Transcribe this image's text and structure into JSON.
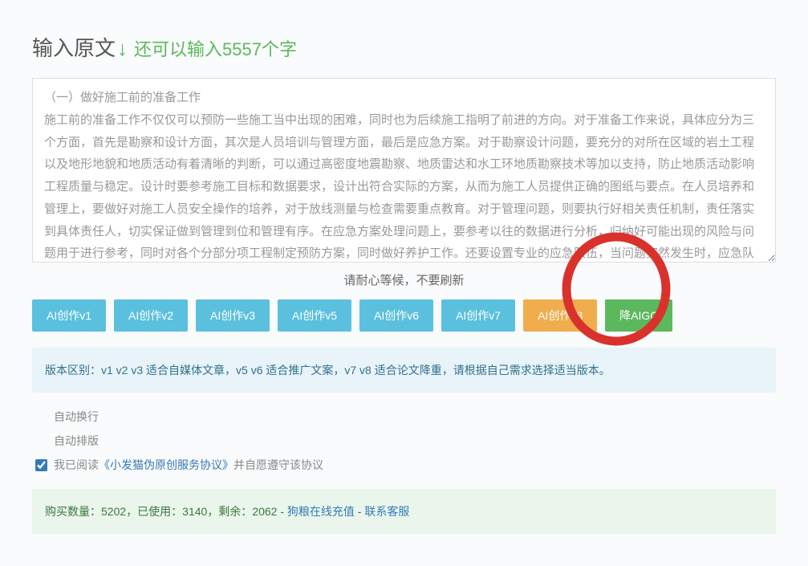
{
  "header": {
    "title": "输入原文",
    "arrow": "↓",
    "counter": "还可以输入5557个字"
  },
  "textarea": {
    "content": "（一）做好施工前的准备工作\n施工前的准备工作不仅仅可以预防一些施工当中出现的困难，同时也为后续施工指明了前进的方向。对于准备工作来说，具体应分为三个方面，首先是勘察和设计方面，其次是人员培训与管理方面，最后是应急方案。对于勘察设计问题，要充分的对所在区域的岩土工程以及地形地貌和地质活动有着清晰的判断，可以通过高密度地震勘察、地质雷达和水工环地质勘察技术等加以支持，防止地质活动影响工程质量与稳定。设计时要参考施工目标和数据要求，设计出符合实际的方案，从而为施工人员提供正确的图纸与要点。在人员培养和管理上，要做好对施工人员安全操作的培养，对于放线测量与检查需要重点教育。对于管理问题，则要执行好相关责任机制，责任落实到具体责任人，切实保证做到管理到位和管理有序。在应急方案处理问题上，要参考以往的数据进行分析，归纳好可能出现的风险与问题用于进行参考，同时对各个分部分项工程制定预防方案，同时做好养护工作。还要设置专业的应急队伍，当问题突然发生时，应急队伍要及时赶赴现场并做好问题的解决。"
  },
  "waiting_message": "请耐心等候，不要刷新",
  "buttons": {
    "v1": "AI创作v1",
    "v2": "AI创作v2",
    "v3": "AI创作v3",
    "v5": "AI创作v5",
    "v6": "AI创作v6",
    "v7": "AI创作v7",
    "v8": "AI创作v8",
    "aigc": "降AIGC"
  },
  "version_info": "版本区别：v1 v2 v3 适合自媒体文章，v5 v6 适合推广文案，v7 v8 适合论文降重，请根据自己需求选择适当版本。",
  "checkboxes": {
    "auto_wrap": "自动换行",
    "auto_format": "自动排版",
    "agreement_prefix": "我已阅读",
    "agreement_link": "《小发猫伪原创服务协议》",
    "agreement_suffix": "并自愿遵守该协议"
  },
  "purchase": {
    "prefix": "购买数量：",
    "total": "5202",
    "sep1": "，已使用：",
    "used": "3140",
    "sep2": "，剩余：",
    "remaining": "2062",
    "dash": " - ",
    "recharge_link": "狗粮在线充值",
    "dash2": " - ",
    "contact_link": "联系客服"
  }
}
